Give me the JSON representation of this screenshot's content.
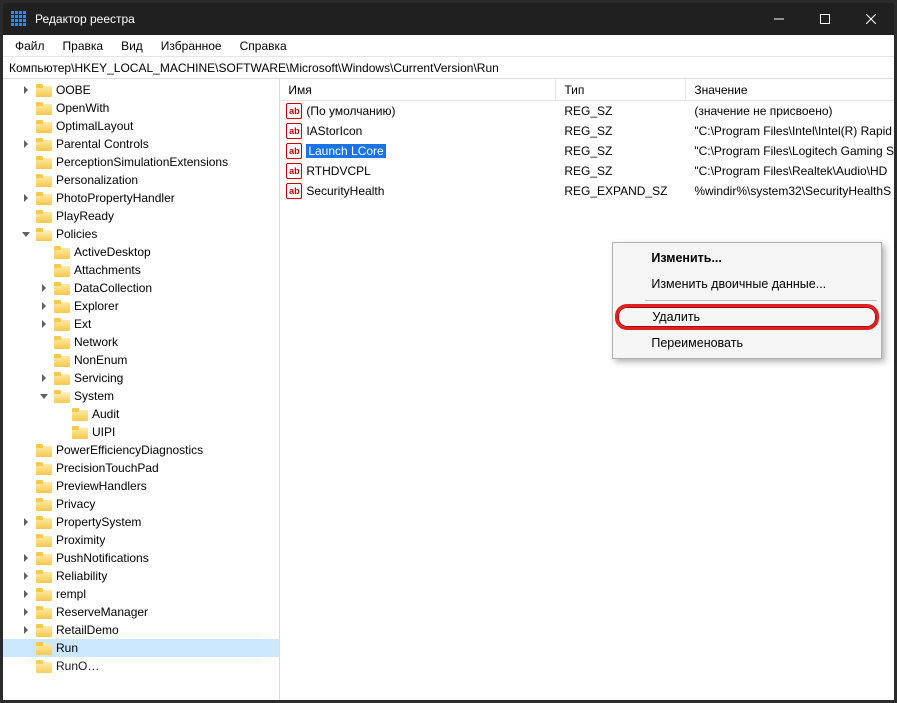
{
  "window": {
    "title": "Редактор реестра"
  },
  "menus": {
    "file": "Файл",
    "edit": "Правка",
    "view": "Вид",
    "favorites": "Избранное",
    "help": "Справка"
  },
  "address": "Компьютер\\HKEY_LOCAL_MACHINE\\SOFTWARE\\Microsoft\\Windows\\CurrentVersion\\Run",
  "tree": {
    "items": [
      {
        "depth": 1,
        "exp": "closed",
        "label": "OOBE"
      },
      {
        "depth": 1,
        "exp": "none",
        "label": "OpenWith"
      },
      {
        "depth": 1,
        "exp": "none",
        "label": "OptimalLayout"
      },
      {
        "depth": 1,
        "exp": "closed",
        "label": "Parental Controls"
      },
      {
        "depth": 1,
        "exp": "none",
        "label": "PerceptionSimulationExtensions"
      },
      {
        "depth": 1,
        "exp": "none",
        "label": "Personalization"
      },
      {
        "depth": 1,
        "exp": "closed",
        "label": "PhotoPropertyHandler"
      },
      {
        "depth": 1,
        "exp": "none",
        "label": "PlayReady"
      },
      {
        "depth": 1,
        "exp": "open",
        "label": "Policies"
      },
      {
        "depth": 2,
        "exp": "none",
        "label": "ActiveDesktop"
      },
      {
        "depth": 2,
        "exp": "none",
        "label": "Attachments"
      },
      {
        "depth": 2,
        "exp": "closed",
        "label": "DataCollection"
      },
      {
        "depth": 2,
        "exp": "closed",
        "label": "Explorer"
      },
      {
        "depth": 2,
        "exp": "closed",
        "label": "Ext"
      },
      {
        "depth": 2,
        "exp": "none",
        "label": "Network"
      },
      {
        "depth": 2,
        "exp": "none",
        "label": "NonEnum"
      },
      {
        "depth": 2,
        "exp": "closed",
        "label": "Servicing"
      },
      {
        "depth": 2,
        "exp": "open",
        "label": "System"
      },
      {
        "depth": 3,
        "exp": "none",
        "label": "Audit"
      },
      {
        "depth": 3,
        "exp": "none",
        "label": "UIPI"
      },
      {
        "depth": 1,
        "exp": "none",
        "label": "PowerEfficiencyDiagnostics"
      },
      {
        "depth": 1,
        "exp": "none",
        "label": "PrecisionTouchPad"
      },
      {
        "depth": 1,
        "exp": "none",
        "label": "PreviewHandlers"
      },
      {
        "depth": 1,
        "exp": "none",
        "label": "Privacy"
      },
      {
        "depth": 1,
        "exp": "closed",
        "label": "PropertySystem"
      },
      {
        "depth": 1,
        "exp": "none",
        "label": "Proximity"
      },
      {
        "depth": 1,
        "exp": "closed",
        "label": "PushNotifications"
      },
      {
        "depth": 1,
        "exp": "closed",
        "label": "Reliability"
      },
      {
        "depth": 1,
        "exp": "closed",
        "label": "rempl"
      },
      {
        "depth": 1,
        "exp": "closed",
        "label": "ReserveManager"
      },
      {
        "depth": 1,
        "exp": "closed",
        "label": "RetailDemo"
      },
      {
        "depth": 1,
        "exp": "none",
        "label": "Run",
        "selected": true
      },
      {
        "depth": 1,
        "exp": "none",
        "label": "RunOnce",
        "cutoff": true
      }
    ]
  },
  "columns": {
    "name": "Имя",
    "type": "Тип",
    "value": "Значение"
  },
  "values": [
    {
      "name": "(По умолчанию)",
      "type": "REG_SZ",
      "value": "(значение не присвоено)"
    },
    {
      "name": "IAStorIcon",
      "type": "REG_SZ",
      "value": "\"C:\\Program Files\\Intel\\Intel(R) Rapid"
    },
    {
      "name": "Launch LCore",
      "type": "REG_SZ",
      "value": "\"C:\\Program Files\\Logitech Gaming S",
      "selected": true
    },
    {
      "name": "RTHDVCPL",
      "type": "REG_SZ",
      "value": "\"C:\\Program Files\\Realtek\\Audio\\HD"
    },
    {
      "name": "SecurityHealth",
      "type": "REG_EXPAND_SZ",
      "value": "%windir%\\system32\\SecurityHealthS"
    }
  ],
  "context_menu": {
    "modify": "Изменить...",
    "modify_binary": "Изменить двоичные данные...",
    "delete": "Удалить",
    "rename": "Переименовать"
  }
}
